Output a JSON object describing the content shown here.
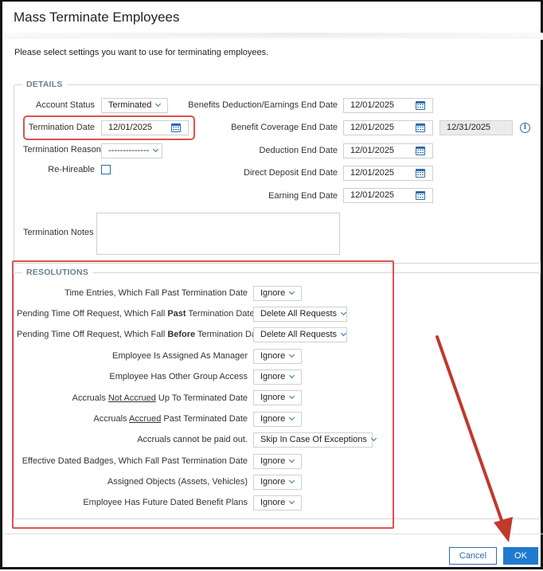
{
  "dialog": {
    "title": "Mass Terminate Employees",
    "instructions": "Please select settings you want to use for terminating employees."
  },
  "details": {
    "legend": "DETAILS",
    "account_status": {
      "label": "Account Status",
      "value": "Terminated"
    },
    "termination_date": {
      "label": "Termination Date",
      "value": "12/01/2025"
    },
    "termination_reason": {
      "label": "Termination Reason",
      "value": "--------------"
    },
    "re_hireable": {
      "label": "Re-Hireable",
      "checked": false
    },
    "termination_notes": {
      "label": "Termination Notes",
      "value": ""
    },
    "benefits_deduction_end": {
      "label": "Benefits Deduction/Earnings End Date",
      "value": "12/01/2025"
    },
    "benefit_coverage_end": {
      "label": "Benefit Coverage End Date",
      "value": "12/01/2025",
      "secondary_value": "12/31/2025"
    },
    "deduction_end": {
      "label": "Deduction End Date",
      "value": "12/01/2025"
    },
    "direct_deposit_end": {
      "label": "Direct Deposit End Date",
      "value": "12/01/2025"
    },
    "earning_end": {
      "label": "Earning End Date",
      "value": "12/01/2025"
    }
  },
  "resolutions": {
    "legend": "RESOLUTIONS",
    "rows": [
      {
        "label": "Time Entries, Which Fall Past Termination Date",
        "value": "Ignore"
      },
      {
        "label_pre": "Pending Time Off Request, Which Fall ",
        "label_em": "Past",
        "label_post": " Termination Date",
        "value": "Delete All Requests"
      },
      {
        "label_pre": "Pending Time Off Request, Which Fall ",
        "label_em": "Before",
        "label_post": " Termination Date",
        "value": "Delete All Requests"
      },
      {
        "label": "Employee Is Assigned As Manager",
        "value": "Ignore"
      },
      {
        "label": "Employee Has Other Group Access",
        "value": "Ignore"
      },
      {
        "label_pre": "Accruals ",
        "label_em": "Not Accrued",
        "label_post": " Up To Terminated Date",
        "value": "Ignore"
      },
      {
        "label_pre": "Accruals ",
        "label_em": "Accrued",
        "label_post": " Past Terminated Date",
        "value": "Ignore"
      },
      {
        "label": "Accruals cannot be paid out.",
        "value": "Skip In Case Of Exceptions"
      },
      {
        "label": "Effective Dated Badges, Which Fall Past Termination Date",
        "value": "Ignore"
      },
      {
        "label": "Assigned Objects (Assets, Vehicles)",
        "value": "Ignore"
      },
      {
        "label": "Employee Has Future Dated Benefit Plans",
        "value": "Ignore"
      }
    ]
  },
  "footer": {
    "cancel_label": "Cancel",
    "ok_label": "OK"
  },
  "annotation_color": "#d9534f",
  "accent_color": "#2b6cb0",
  "icons": [
    "calendar-icon",
    "chevron-down-icon",
    "info-icon",
    "arrow-annotation"
  ]
}
